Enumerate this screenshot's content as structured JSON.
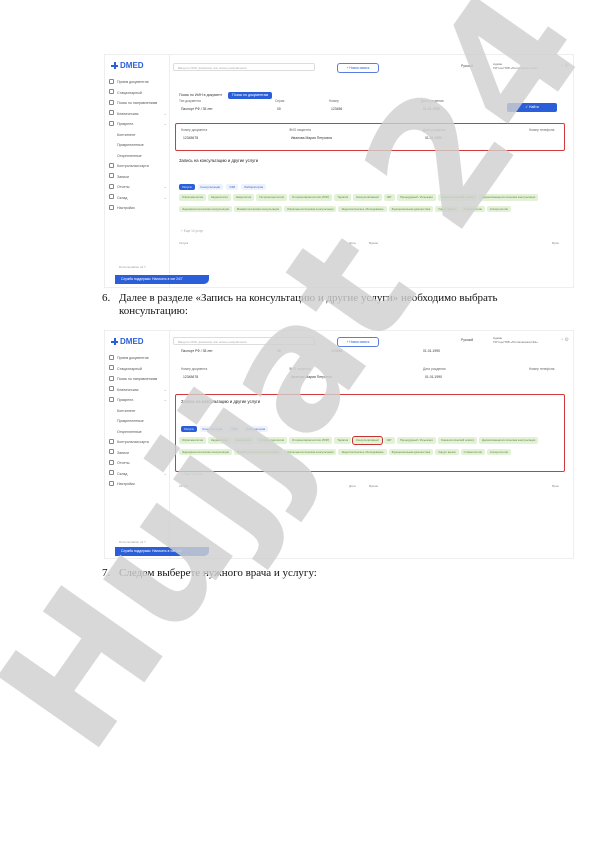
{
  "sidebar": {
    "logo": "DMED",
    "shot1_items": [
      {
        "label": "Прием документов",
        "sub": false,
        "chev": false
      },
      {
        "label": "Стационарный",
        "sub": false,
        "chev": false
      },
      {
        "label": "Поиск по направлениям",
        "sub": false,
        "chev": false
      },
      {
        "label": "Клиническая",
        "sub": false,
        "chev": true
      },
      {
        "label": "Прикрепл.",
        "sub": false,
        "chev": true
      },
      {
        "label": "Контингент",
        "sub": true,
        "chev": false
      },
      {
        "label": "Прикрепленные",
        "sub": true,
        "chev": false
      },
      {
        "label": "Открепленные",
        "sub": true,
        "chev": false
      },
      {
        "label": "Контрольная карта",
        "sub": false,
        "chev": false
      },
      {
        "label": "Записи",
        "sub": false,
        "chev": false
      },
      {
        "label": "Отчеты",
        "sub": false,
        "chev": true
      },
      {
        "label": "Склад",
        "sub": false,
        "chev": true
      },
      {
        "label": "Настройки",
        "sub": false,
        "chev": false
      }
    ],
    "shot2_items": [
      {
        "label": "Прием документов",
        "sub": false,
        "chev": false
      },
      {
        "label": "Стационарный",
        "sub": false,
        "chev": false
      },
      {
        "label": "Поиск по направлениям",
        "sub": false,
        "chev": false
      },
      {
        "label": "Клиническая",
        "sub": false,
        "chev": true
      },
      {
        "label": "Прикрепл.",
        "sub": false,
        "chev": true
      },
      {
        "label": "Контингент",
        "sub": true,
        "chev": false
      },
      {
        "label": "Прикрепленные",
        "sub": true,
        "chev": false
      },
      {
        "label": "Открепленные",
        "sub": true,
        "chev": false
      },
      {
        "label": "Контрольная карта",
        "sub": false,
        "chev": false
      },
      {
        "label": "Записи",
        "sub": false,
        "chev": false
      },
      {
        "label": "Отчеты",
        "sub": false,
        "chev": false
      },
      {
        "label": "Склад",
        "sub": false,
        "chev": true
      },
      {
        "label": "Настройки",
        "sub": false,
        "chev": false
      }
    ],
    "help_label": "Служба поддержки: Написать в чат 24/7",
    "side_note": "Documentation v2.7"
  },
  "topbar": {
    "search_placeholder": "Введите ИИН, фамилию или номер направления",
    "add_button": "+ Новая запись",
    "lang": "Русский",
    "user_name": "Админ",
    "user_org": "ГКП на ПХВ «Поликлиника №1»"
  },
  "tabs": [
    "Поиск по ИИН в документ",
    "Поиск по документам"
  ],
  "search_form": {
    "labels": [
      "Тип документа",
      "Серия",
      "Номер",
      "Дата рождения"
    ],
    "values": [
      "Паспорт РФ / 35 лет",
      "00",
      "123456",
      "01.01.1990"
    ],
    "find_button": "Найти"
  },
  "patient": {
    "labels": [
      "Номер документа",
      "ФИО пациента",
      "Дата рождения",
      "Номер телефона"
    ],
    "values": [
      "12345678",
      "Ивановa Мария Петровна",
      "01.01.1990",
      ""
    ]
  },
  "services": {
    "title": "Запись на консультацию и другие услуги",
    "filters": [
      "Услуги",
      "Консультации",
      "УЗИ",
      "Лаборатория"
    ],
    "chips": [
      "Офтальмология",
      "Кардиология",
      "Неврология",
      "Гастроэнтерология",
      "Оториноларингология (ЛОР)",
      "Терапия",
      "Консультативный",
      "ЭКГ",
      "Процедурный / Инъекции",
      "Гинекологический осмотр",
      "Дерматовенерологическая консультация",
      "Эндокринологическая консультация",
      "Маммологическая консультация",
      "Офтальмологическая консультация",
      "Эндоскопическое обследование",
      "Функциональная диагностика",
      "Хирург вызов",
      "Стоматология",
      "Аллергология"
    ],
    "more_label": "+ Еще 14 услуг",
    "table_headers": [
      "Услуга",
      "Дата",
      "Время",
      "Врач"
    ]
  },
  "steps": [
    {
      "num": "6.",
      "line1": "Далее в разделе «Запись на консультацию и другие услуги» необходимо выбрать",
      "line2": "консультацию:"
    },
    {
      "num": "7.",
      "line1": "Следом выберете нужного врача и услугу:",
      "line2": ""
    }
  ],
  "watermark": "Hujjat 24"
}
